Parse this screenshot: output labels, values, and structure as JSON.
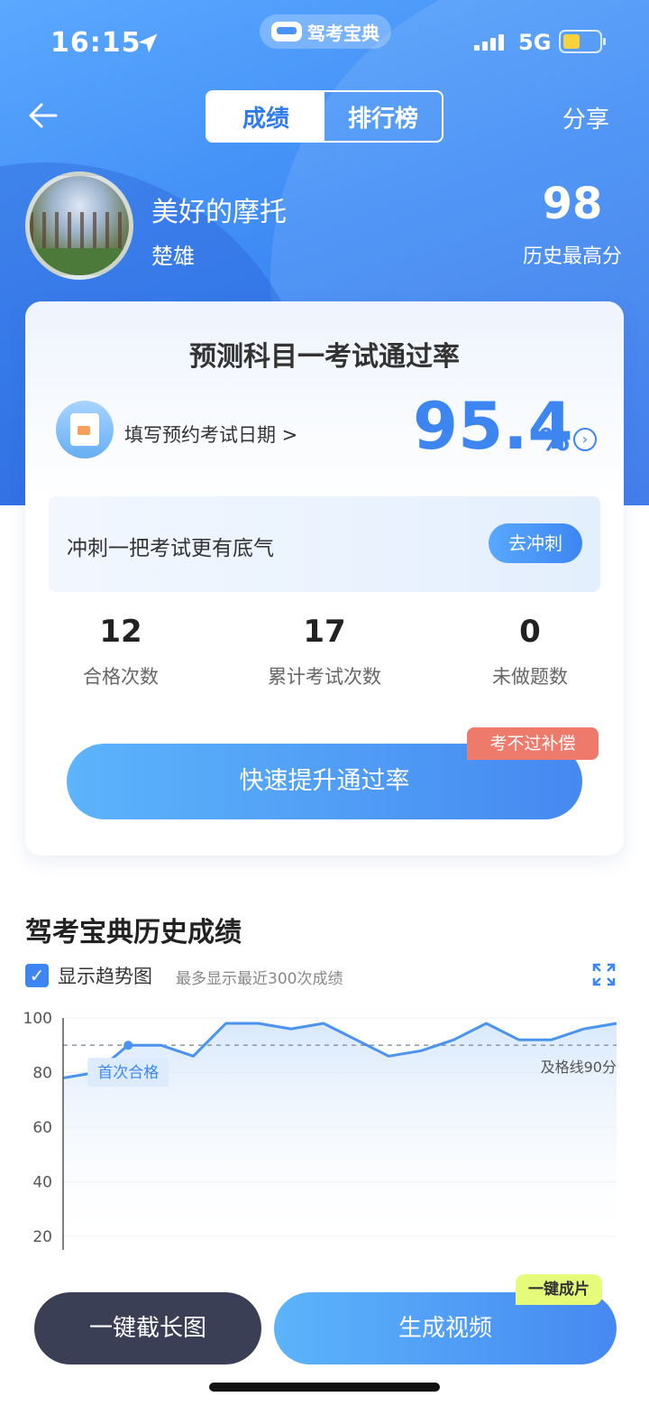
{
  "status_bar": {
    "time": "16:15",
    "network": "5G",
    "app_pill": "驾考宝典"
  },
  "nav": {
    "tabs": [
      "成绩",
      "排行榜"
    ],
    "share": "分享"
  },
  "user": {
    "name": "美好的摩托",
    "city": "楚雄",
    "best_score": "98",
    "best_score_label": "历史最高分"
  },
  "card": {
    "title": "预测科目一考试通过率",
    "date_link": "填写预约考试日期 >",
    "pass_rate": "95.4",
    "pass_rate_unit": "%",
    "sprint_text": "冲刺一把考试更有底气",
    "sprint_button": "去冲刺",
    "stats": [
      {
        "value": "12",
        "label": "合格次数"
      },
      {
        "value": "17",
        "label": "累计考试次数"
      },
      {
        "value": "0",
        "label": "未做题数"
      }
    ],
    "badge": "考不过补偿",
    "boost_button": "快速提升通过率"
  },
  "history": {
    "title": "驾考宝典历史成绩",
    "show_trend": "显示趋势图",
    "note": "最多显示最近300次成绩"
  },
  "chart_data": {
    "type": "line",
    "x": [
      1,
      2,
      3,
      4,
      5,
      6,
      7,
      8,
      9,
      10,
      11,
      12,
      13,
      14,
      15,
      16,
      17,
      18
    ],
    "values": [
      78,
      80,
      90,
      90,
      86,
      98,
      98,
      96,
      98,
      92,
      86,
      88,
      92,
      98,
      92,
      92,
      96,
      98
    ],
    "ylim": [
      15,
      100
    ],
    "yticks": [
      "100",
      "80",
      "60",
      "40",
      "20"
    ],
    "pass_line": 90,
    "pass_line_label": "及格线90分",
    "first_pass_index": 2,
    "first_pass_label": "首次合格",
    "color": "#4a93ef"
  },
  "bottom": {
    "screenshot_button": "一键截长图",
    "video_button": "生成视频",
    "video_badge": "一键成片"
  }
}
